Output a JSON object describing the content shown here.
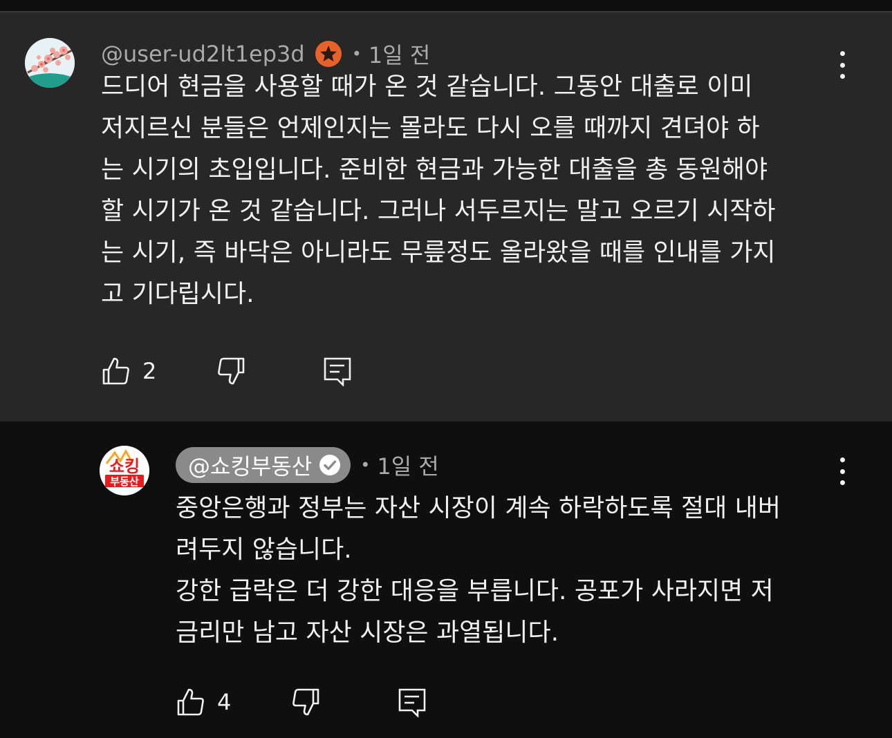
{
  "comments": [
    {
      "handle": "@user-ud2lt1ep3d",
      "separator": "•",
      "time": "1일 전",
      "text": "드디어 현금을 사용할 때가 온 것 같습니다. 그동안 대출로 이미\n저지르신 분들은 언제인지는 몰라도 다시 오를 때까지 견뎌야 하\n는 시기의 초입입니다. 준비한 현금과 가능한 대출을 총 동원해야\n할 시기가 온 것 같습니다. 그러나 서두르지는 말고 오르기 시작하\n는 시기, 즉 바닥은 아니라도 무릎정도 올라왔을 때를 인내를 가지\n고 기다립시다.",
      "likes": "2",
      "badge_icon": "star-badge-icon"
    },
    {
      "handle": "@쇼킹부동산",
      "separator": "•",
      "time": "1일 전",
      "text": "중앙은행과 정부는 자산 시장이 계속 하락하도록 절대 내버\n려두지 않습니다.\n강한 급락은 더 강한 대응을 부릅니다. 공포가 사라지면 저\n금리만 남고 자산 시장은 과열됩니다.",
      "likes": "4",
      "avatar_text_top": "쇼킹",
      "avatar_text_bottom": "부동산",
      "badge_icon": "verified-check-icon"
    }
  ],
  "colors": {
    "top_comment_bg": "#272727",
    "reply_bg": "#0f0f0f",
    "meta_text": "#aaaaaa",
    "badge_orange": "#e8622c",
    "pill_bg": "#8a8a8a",
    "avatar_red": "#e41e1e"
  }
}
